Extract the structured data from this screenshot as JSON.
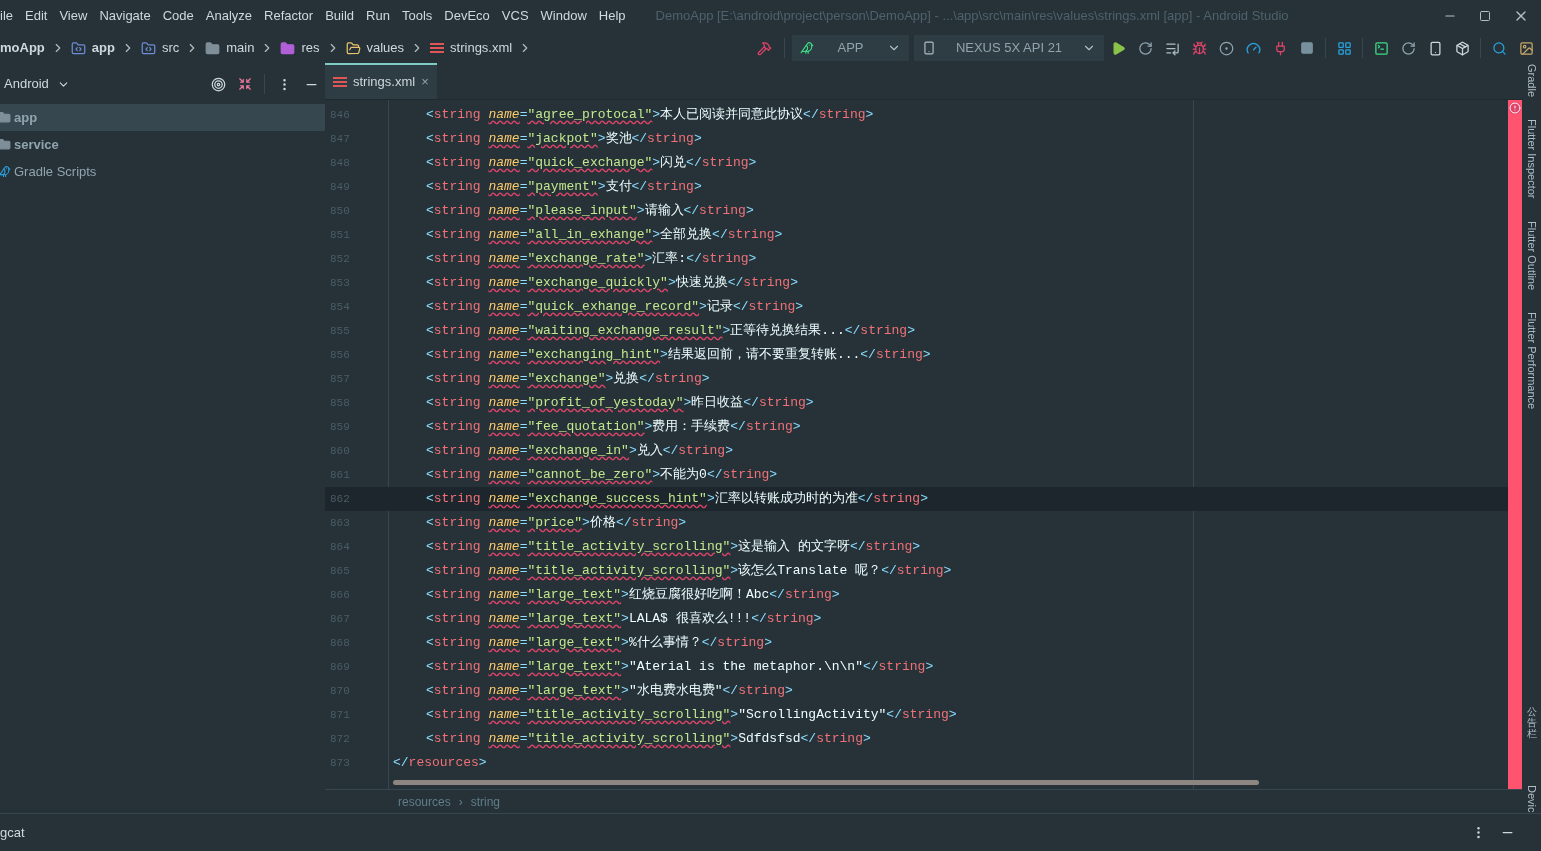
{
  "menu": [
    "ile",
    "Edit",
    "View",
    "Navigate",
    "Code",
    "Analyze",
    "Refactor",
    "Build",
    "Run",
    "Tools",
    "DevEco",
    "VCS",
    "Window",
    "Help"
  ],
  "window_title": "DemoApp [E:\\android\\project\\person\\DemoApp] - ...\\app\\src\\main\\res\\values\\strings.xml [app] - Android Studio",
  "breadcrumb": [
    {
      "label": "moApp",
      "kind": "project"
    },
    {
      "label": "app",
      "kind": "module"
    },
    {
      "label": "src",
      "kind": "source"
    },
    {
      "label": "main",
      "kind": "folder"
    },
    {
      "label": "res",
      "kind": "resources"
    },
    {
      "label": "values",
      "kind": "values"
    },
    {
      "label": "strings.xml",
      "kind": "xml"
    }
  ],
  "run_config": "APP",
  "device": "NEXUS 5X API 21",
  "project_view": "Android",
  "tree": [
    {
      "label": "app",
      "kind": "module",
      "selected": true
    },
    {
      "label": "service",
      "kind": "module",
      "selected": false
    },
    {
      "label": "Gradle Scripts",
      "kind": "gradle",
      "selected": false
    }
  ],
  "tabs": [
    {
      "label": "strings.xml",
      "close": "×",
      "selected": true
    }
  ],
  "lines": [
    {
      "number": "846",
      "kind": "element",
      "current": false,
      "lt": "<",
      "tag": "string",
      "attr": "name",
      "eq": "=",
      "name": "\"agree_protocal\"",
      "gt": ">",
      "text": "本人已阅读并同意此协议",
      "close_lt": "</",
      "close_tag": "string",
      "close_gt": ">"
    },
    {
      "number": "847",
      "kind": "element",
      "current": false,
      "lt": "<",
      "tag": "string",
      "attr": "name",
      "eq": "=",
      "name": "\"jackpot\"",
      "gt": ">",
      "text": "奖池",
      "close_lt": "</",
      "close_tag": "string",
      "close_gt": ">"
    },
    {
      "number": "848",
      "kind": "element",
      "current": false,
      "lt": "<",
      "tag": "string",
      "attr": "name",
      "eq": "=",
      "name": "\"quick_exchange\"",
      "gt": ">",
      "text": "闪兑",
      "close_lt": "</",
      "close_tag": "string",
      "close_gt": ">"
    },
    {
      "number": "849",
      "kind": "element",
      "current": false,
      "lt": "<",
      "tag": "string",
      "attr": "name",
      "eq": "=",
      "name": "\"payment\"",
      "gt": ">",
      "text": "支付",
      "close_lt": "</",
      "close_tag": "string",
      "close_gt": ">"
    },
    {
      "number": "850",
      "kind": "element",
      "current": false,
      "lt": "<",
      "tag": "string",
      "attr": "name",
      "eq": "=",
      "name": "\"please_input\"",
      "gt": ">",
      "text": "请输入",
      "close_lt": "</",
      "close_tag": "string",
      "close_gt": ">"
    },
    {
      "number": "851",
      "kind": "element",
      "current": false,
      "lt": "<",
      "tag": "string",
      "attr": "name",
      "eq": "=",
      "name": "\"all_in_exhange\"",
      "gt": ">",
      "text": "全部兑换",
      "close_lt": "</",
      "close_tag": "string",
      "close_gt": ">"
    },
    {
      "number": "852",
      "kind": "element",
      "current": false,
      "lt": "<",
      "tag": "string",
      "attr": "name",
      "eq": "=",
      "name": "\"exchange_rate\"",
      "gt": ">",
      "text": "汇率:",
      "close_lt": "</",
      "close_tag": "string",
      "close_gt": ">"
    },
    {
      "number": "853",
      "kind": "element",
      "current": false,
      "lt": "<",
      "tag": "string",
      "attr": "name",
      "eq": "=",
      "name": "\"exchange_quickly\"",
      "gt": ">",
      "text": "快速兑换",
      "close_lt": "</",
      "close_tag": "string",
      "close_gt": ">"
    },
    {
      "number": "854",
      "kind": "element",
      "current": false,
      "lt": "<",
      "tag": "string",
      "attr": "name",
      "eq": "=",
      "name": "\"quick_exhange_record\"",
      "gt": ">",
      "text": "记录",
      "close_lt": "</",
      "close_tag": "string",
      "close_gt": ">"
    },
    {
      "number": "855",
      "kind": "element",
      "current": false,
      "lt": "<",
      "tag": "string",
      "attr": "name",
      "eq": "=",
      "name": "\"waiting_exchange_result\"",
      "gt": ">",
      "text": "正等待兑换结果...",
      "close_lt": "</",
      "close_tag": "string",
      "close_gt": ">"
    },
    {
      "number": "856",
      "kind": "element",
      "current": false,
      "lt": "<",
      "tag": "string",
      "attr": "name",
      "eq": "=",
      "name": "\"exchanging_hint\"",
      "gt": ">",
      "text": "结果返回前，请不要重复转账...",
      "close_lt": "</",
      "close_tag": "string",
      "close_gt": ">"
    },
    {
      "number": "857",
      "kind": "element",
      "current": false,
      "lt": "<",
      "tag": "string",
      "attr": "name",
      "eq": "=",
      "name": "\"exchange\"",
      "gt": ">",
      "text": "兑换",
      "close_lt": "</",
      "close_tag": "string",
      "close_gt": ">"
    },
    {
      "number": "858",
      "kind": "element",
      "current": false,
      "lt": "<",
      "tag": "string",
      "attr": "name",
      "eq": "=",
      "name": "\"profit_of_yestoday\"",
      "gt": ">",
      "text": "昨日收益",
      "close_lt": "</",
      "close_tag": "string",
      "close_gt": ">"
    },
    {
      "number": "859",
      "kind": "element",
      "current": false,
      "lt": "<",
      "tag": "string",
      "attr": "name",
      "eq": "=",
      "name": "\"fee_quotation\"",
      "gt": ">",
      "text": "费用：手续费",
      "close_lt": "</",
      "close_tag": "string",
      "close_gt": ">"
    },
    {
      "number": "860",
      "kind": "element",
      "current": false,
      "lt": "<",
      "tag": "string",
      "attr": "name",
      "eq": "=",
      "name": "\"exchange_in\"",
      "gt": ">",
      "text": "兑入",
      "close_lt": "</",
      "close_tag": "string",
      "close_gt": ">"
    },
    {
      "number": "861",
      "kind": "element",
      "current": false,
      "lt": "<",
      "tag": "string",
      "attr": "name",
      "eq": "=",
      "name": "\"cannot_be_zero\"",
      "gt": ">",
      "text": "不能为0",
      "close_lt": "</",
      "close_tag": "string",
      "close_gt": ">"
    },
    {
      "number": "862",
      "kind": "element",
      "current": true,
      "lt": "<",
      "tag": "string",
      "attr": "name",
      "eq": "=",
      "name": "\"exchange_success_hint\"",
      "gt": ">",
      "text": "汇率以转账成功时的为准",
      "close_lt": "</",
      "close_tag": "string",
      "close_gt": ">"
    },
    {
      "number": "863",
      "kind": "element",
      "current": false,
      "lt": "<",
      "tag": "string",
      "attr": "name",
      "eq": "=",
      "name": "\"price\"",
      "gt": ">",
      "text": "价格",
      "close_lt": "</",
      "close_tag": "string",
      "close_gt": ">"
    },
    {
      "number": "864",
      "kind": "element",
      "current": false,
      "lt": "<",
      "tag": "string",
      "attr": "name",
      "eq": "=",
      "name": "\"title_activity_scrolling\"",
      "gt": ">",
      "text": "这是输入 的文字呀",
      "close_lt": "</",
      "close_tag": "string",
      "close_gt": ">"
    },
    {
      "number": "865",
      "kind": "element",
      "current": false,
      "lt": "<",
      "tag": "string",
      "attr": "name",
      "eq": "=",
      "name": "\"title_activity_scrolling\"",
      "gt": ">",
      "text": "该怎么Translate 呢？",
      "close_lt": "</",
      "close_tag": "string",
      "close_gt": ">"
    },
    {
      "number": "866",
      "kind": "element",
      "current": false,
      "lt": "<",
      "tag": "string",
      "attr": "name",
      "eq": "=",
      "name": "\"large_text\"",
      "gt": ">",
      "text": "红烧豆腐很好吃啊！Abc",
      "close_lt": "</",
      "close_tag": "string",
      "close_gt": ">"
    },
    {
      "number": "867",
      "kind": "element",
      "current": false,
      "lt": "<",
      "tag": "string",
      "attr": "name",
      "eq": "=",
      "name": "\"large_text\"",
      "gt": ">",
      "text": "LALA$ 很喜欢么!!!",
      "close_lt": "</",
      "close_tag": "string",
      "close_gt": ">"
    },
    {
      "number": "868",
      "kind": "element",
      "current": false,
      "lt": "<",
      "tag": "string",
      "attr": "name",
      "eq": "=",
      "name": "\"large_text\"",
      "gt": ">",
      "text": "%什么事情？",
      "close_lt": "</",
      "close_tag": "string",
      "close_gt": ">"
    },
    {
      "number": "869",
      "kind": "element",
      "current": false,
      "lt": "<",
      "tag": "string",
      "attr": "name",
      "eq": "=",
      "name": "\"large_text\"",
      "gt": ">",
      "text": "\"Aterial is the metaphor.\\n\\n\"",
      "close_lt": "</",
      "close_tag": "string",
      "close_gt": ">"
    },
    {
      "number": "870",
      "kind": "element",
      "current": false,
      "lt": "<",
      "tag": "string",
      "attr": "name",
      "eq": "=",
      "name": "\"large_text\"",
      "gt": ">",
      "text": "\"水电费水电费\"",
      "close_lt": "</",
      "close_tag": "string",
      "close_gt": ">"
    },
    {
      "number": "871",
      "kind": "element",
      "current": false,
      "lt": "<",
      "tag": "string",
      "attr": "name",
      "eq": "=",
      "name": "\"title_activity_scrolling\"",
      "gt": ">",
      "text": "\"ScrollingActivity\"",
      "close_lt": "</",
      "close_tag": "string",
      "close_gt": ">"
    },
    {
      "number": "872",
      "kind": "element",
      "current": false,
      "lt": "<",
      "tag": "string",
      "attr": "name",
      "eq": "=",
      "name": "\"title_activity_scrolling\"",
      "gt": ">",
      "text": "Sdfdsfsd",
      "close_lt": "</",
      "close_tag": "string",
      "close_gt": ">"
    },
    {
      "number": "873",
      "kind": "end",
      "current": false,
      "close_lt": "</",
      "close_tag": "resources",
      "close_gt": ">"
    }
  ],
  "editor_breadcrumb": [
    "resources",
    "›",
    "string"
  ],
  "side_tools": [
    {
      "label": "Gradle",
      "kind": "latin"
    },
    {
      "label": "Flutter Inspector",
      "kind": "latin"
    },
    {
      "label": "Flutter Outline",
      "kind": "latin"
    },
    {
      "label": "Flutter Performance",
      "kind": "latin"
    },
    {
      "label": "公告栏",
      "kind": "cjk"
    },
    {
      "label": "Devic",
      "kind": "latin"
    }
  ],
  "bottom_tool": "gcat"
}
